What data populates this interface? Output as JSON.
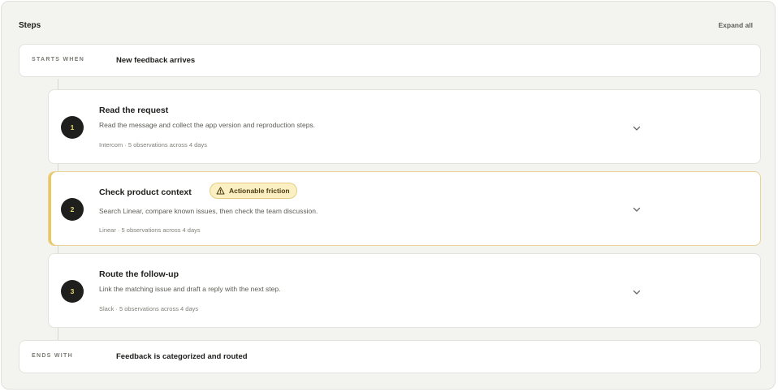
{
  "header": {
    "title": "Steps",
    "expand_label": "Expand all"
  },
  "start": {
    "kind": "STARTS WHEN",
    "text": "New feedback arrives"
  },
  "end": {
    "kind": "ENDS WITH",
    "text": "Feedback is categorized and routed"
  },
  "steps": [
    {
      "number": "1",
      "title": "Read the request",
      "description": "Read the message and collect the app version and reproduction steps.",
      "meta": "Intercom · 5 observations across 4 days"
    },
    {
      "number": "2",
      "title": "Check product context",
      "badge": "Actionable friction",
      "description": "Search Linear, compare known issues, then check the team discussion.",
      "meta": "Linear · 5 observations across 4 days"
    },
    {
      "number": "3",
      "title": "Route the follow-up",
      "description": "Link the matching issue and draft a reply with the next step.",
      "meta": "Slack · 5 observations across 4 days"
    }
  ],
  "colors": {
    "panel_bg": "#f3f3ef",
    "step_number_bg": "#1f1f1d",
    "step_number_text": "#e6d86c",
    "highlight_border": "#e8c860",
    "badge_bg": "#fbefc4"
  },
  "icons": {
    "badge_icon": "warning-triangle-icon",
    "step_toggle_icon": "chevron-down-icon"
  }
}
